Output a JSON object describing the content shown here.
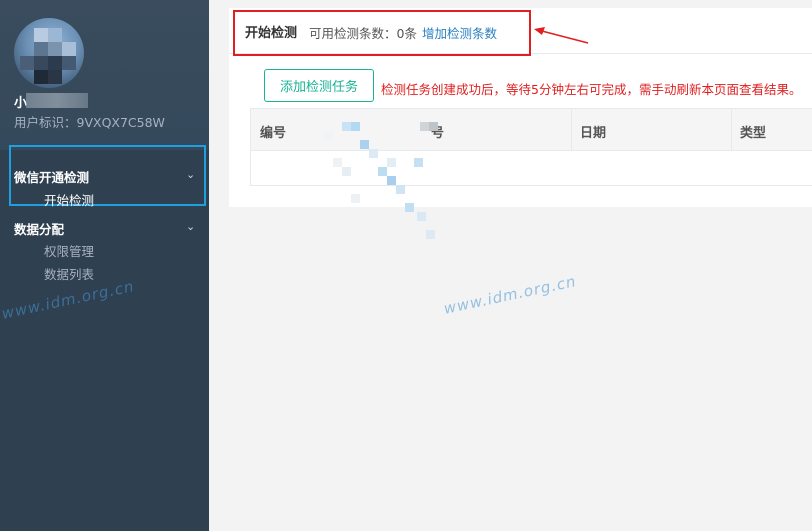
{
  "user": {
    "name_visible": "小",
    "id_line": "用户标识：9VXQX7C58W"
  },
  "sidebar": {
    "groups": [
      {
        "label": "微信开通检测",
        "items": [
          "开始检测"
        ]
      },
      {
        "label": "数据分配",
        "items": [
          "权限管理",
          "数据列表"
        ]
      }
    ]
  },
  "header": {
    "title": "开始检测",
    "available": "可用检测条数：0条",
    "add_link": "增加检测条数"
  },
  "toolbar": {
    "add_task": "添加检测任务",
    "notice": "检测任务创建成功后，等待5分钟左右可完成，需手动刷新本页面查看结果。"
  },
  "table": {
    "columns": [
      "编号",
      "号",
      "日期",
      "类型"
    ]
  },
  "watermark": "www.idm.org.cn",
  "colors": {
    "sidebar": "#2f4050",
    "accent": "#1ab394",
    "highlight_red": "#e02020",
    "highlight_blue": "#1ea0e0"
  }
}
